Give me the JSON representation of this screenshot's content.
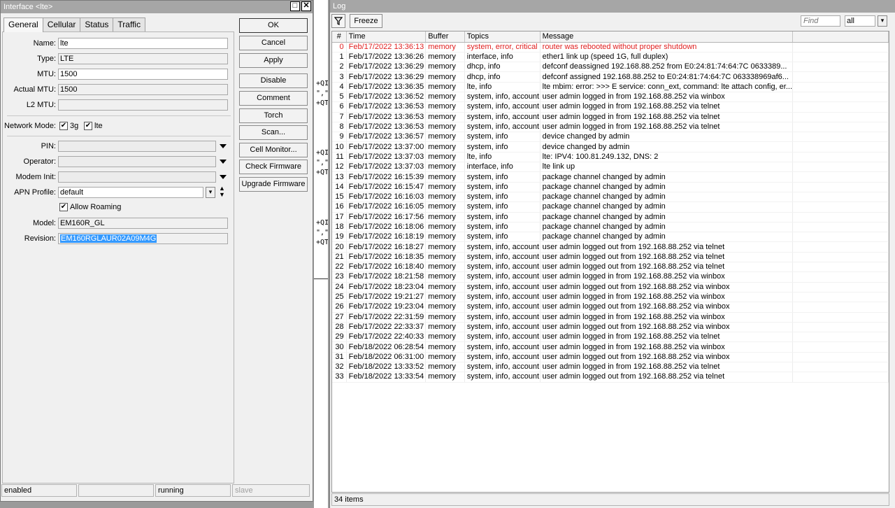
{
  "interface_window": {
    "title": "Interface <lte>",
    "tabs": [
      "General",
      "Cellular",
      "Status",
      "Traffic"
    ],
    "fields": {
      "name": {
        "label": "Name:",
        "value": "lte"
      },
      "type": {
        "label": "Type:",
        "value": "LTE"
      },
      "mtu": {
        "label": "MTU:",
        "value": "1500"
      },
      "actual_mtu": {
        "label": "Actual MTU:",
        "value": "1500"
      },
      "l2_mtu": {
        "label": "L2 MTU:",
        "value": ""
      },
      "network_mode": {
        "label": "Network Mode:",
        "opt1": "3g",
        "opt2": "lte"
      },
      "pin": {
        "label": "PIN:",
        "value": ""
      },
      "operator": {
        "label": "Operator:",
        "value": ""
      },
      "modem_init": {
        "label": "Modem Init:",
        "value": ""
      },
      "apn_profile": {
        "label": "APN Profile:",
        "value": "default"
      },
      "allow_roaming": {
        "label": "Allow Roaming"
      },
      "model": {
        "label": "Model:",
        "value": "EM160R_GL"
      },
      "revision": {
        "label": "Revision:",
        "value": "EM160RGLAUR02A09M4G"
      }
    },
    "buttons": {
      "ok": "OK",
      "cancel": "Cancel",
      "apply": "Apply",
      "disable": "Disable",
      "comment": "Comment",
      "torch": "Torch",
      "scan": "Scan...",
      "cell_monitor": "Cell Monitor...",
      "check_firmware": "Check Firmware",
      "upgrade_firmware": "Upgrade Firmware"
    },
    "status": {
      "s1": "enabled",
      "s2": "",
      "s3": "running",
      "s4": "slave"
    }
  },
  "background_fragments": [
    "+QI",
    "\",\"",
    "+QTI",
    "+QI",
    "\",\"",
    "+QTI",
    "+QI",
    "\",\"",
    "+QTI"
  ],
  "log_window": {
    "title": "Log",
    "freeze_label": "Freeze",
    "find_placeholder": "Find",
    "filter_value": "all",
    "columns": [
      "#",
      "Time",
      "Buffer",
      "Topics",
      "Message"
    ],
    "rows": [
      [
        "0",
        "Feb/17/2022 13:36:13",
        "memory",
        "system, error, critical",
        "router was rebooted without proper shutdown"
      ],
      [
        "1",
        "Feb/17/2022 13:36:26",
        "memory",
        "interface, info",
        "ether1 link up (speed 1G, full duplex)"
      ],
      [
        "2",
        "Feb/17/2022 13:36:29",
        "memory",
        "dhcp, info",
        "defconf deassigned 192.168.88.252 from E0:24:81:74:64:7C 0633389..."
      ],
      [
        "3",
        "Feb/17/2022 13:36:29",
        "memory",
        "dhcp, info",
        "defconf assigned 192.168.88.252 to E0:24:81:74:64:7C 063338969af6..."
      ],
      [
        "4",
        "Feb/17/2022 13:36:35",
        "memory",
        "lte, info",
        "lte mbim: error: >>> E service: conn_ext, command: lte attach config, er..."
      ],
      [
        "5",
        "Feb/17/2022 13:36:52",
        "memory",
        "system, info, account",
        "user admin logged in from 192.168.88.252 via winbox"
      ],
      [
        "6",
        "Feb/17/2022 13:36:53",
        "memory",
        "system, info, account",
        "user admin logged in from 192.168.88.252 via telnet"
      ],
      [
        "7",
        "Feb/17/2022 13:36:53",
        "memory",
        "system, info, account",
        "user admin logged in from 192.168.88.252 via telnet"
      ],
      [
        "8",
        "Feb/17/2022 13:36:53",
        "memory",
        "system, info, account",
        "user admin logged in from 192.168.88.252 via telnet"
      ],
      [
        "9",
        "Feb/17/2022 13:36:57",
        "memory",
        "system, info",
        "device changed by admin"
      ],
      [
        "10",
        "Feb/17/2022 13:37:00",
        "memory",
        "system, info",
        "device changed by admin"
      ],
      [
        "11",
        "Feb/17/2022 13:37:03",
        "memory",
        "lte, info",
        "lte: IPV4: 100.81.249.132, DNS: 2"
      ],
      [
        "12",
        "Feb/17/2022 13:37:03",
        "memory",
        "interface, info",
        "lte link up"
      ],
      [
        "13",
        "Feb/17/2022 16:15:39",
        "memory",
        "system, info",
        "package channel changed by admin"
      ],
      [
        "14",
        "Feb/17/2022 16:15:47",
        "memory",
        "system, info",
        "package channel changed by admin"
      ],
      [
        "15",
        "Feb/17/2022 16:16:03",
        "memory",
        "system, info",
        "package channel changed by admin"
      ],
      [
        "16",
        "Feb/17/2022 16:16:05",
        "memory",
        "system, info",
        "package channel changed by admin"
      ],
      [
        "17",
        "Feb/17/2022 16:17:56",
        "memory",
        "system, info",
        "package channel changed by admin"
      ],
      [
        "18",
        "Feb/17/2022 16:18:06",
        "memory",
        "system, info",
        "package channel changed by admin"
      ],
      [
        "19",
        "Feb/17/2022 16:18:19",
        "memory",
        "system, info",
        "package channel changed by admin"
      ],
      [
        "20",
        "Feb/17/2022 16:18:27",
        "memory",
        "system, info, account",
        "user admin logged out from 192.168.88.252 via telnet"
      ],
      [
        "21",
        "Feb/17/2022 16:18:35",
        "memory",
        "system, info, account",
        "user admin logged out from 192.168.88.252 via telnet"
      ],
      [
        "22",
        "Feb/17/2022 16:18:40",
        "memory",
        "system, info, account",
        "user admin logged out from 192.168.88.252 via telnet"
      ],
      [
        "23",
        "Feb/17/2022 18:21:58",
        "memory",
        "system, info, account",
        "user admin logged in from 192.168.88.252 via winbox"
      ],
      [
        "24",
        "Feb/17/2022 18:23:04",
        "memory",
        "system, info, account",
        "user admin logged out from 192.168.88.252 via winbox"
      ],
      [
        "25",
        "Feb/17/2022 19:21:27",
        "memory",
        "system, info, account",
        "user admin logged in from 192.168.88.252 via winbox"
      ],
      [
        "26",
        "Feb/17/2022 19:23:04",
        "memory",
        "system, info, account",
        "user admin logged out from 192.168.88.252 via winbox"
      ],
      [
        "27",
        "Feb/17/2022 22:31:59",
        "memory",
        "system, info, account",
        "user admin logged in from 192.168.88.252 via winbox"
      ],
      [
        "28",
        "Feb/17/2022 22:33:37",
        "memory",
        "system, info, account",
        "user admin logged out from 192.168.88.252 via winbox"
      ],
      [
        "29",
        "Feb/17/2022 22:40:33",
        "memory",
        "system, info, account",
        "user admin logged in from 192.168.88.252 via telnet"
      ],
      [
        "30",
        "Feb/18/2022 06:28:54",
        "memory",
        "system, info, account",
        "user admin logged in from 192.168.88.252 via winbox"
      ],
      [
        "31",
        "Feb/18/2022 06:31:00",
        "memory",
        "system, info, account",
        "user admin logged out from 192.168.88.252 via winbox"
      ],
      [
        "32",
        "Feb/18/2022 13:33:52",
        "memory",
        "system, info, account",
        "user admin logged in from 192.168.88.252 via telnet"
      ],
      [
        "33",
        "Feb/18/2022 13:33:54",
        "memory",
        "system, info, account",
        "user admin logged out from 192.168.88.252 via telnet"
      ]
    ],
    "item_count": "34 items"
  },
  "colors": {
    "critical": "#e02020",
    "selection": "#3399ff",
    "titlebar": "#a6a6a6"
  }
}
